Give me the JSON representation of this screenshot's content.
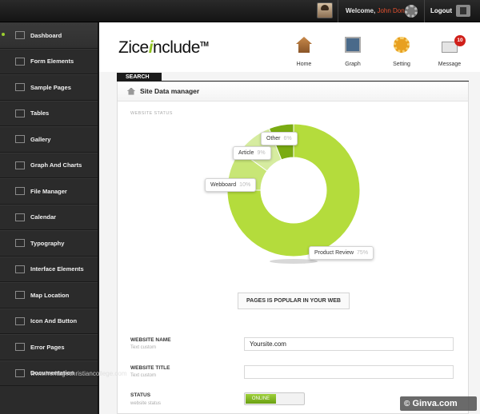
{
  "topbar": {
    "welcome_prefix": "Welcome,",
    "username": "John Don",
    "logout_label": "Logout"
  },
  "sidebar": {
    "items": [
      {
        "label": "Dashboard",
        "icon": "home-icon",
        "active": true
      },
      {
        "label": "Form Elements",
        "icon": "form-icon"
      },
      {
        "label": "Sample Pages",
        "icon": "page-icon"
      },
      {
        "label": "Tables",
        "icon": "table-icon"
      },
      {
        "label": "Gallery",
        "icon": "gallery-icon"
      },
      {
        "label": "Graph And Charts",
        "icon": "chart-icon"
      },
      {
        "label": "File Manager",
        "icon": "folder-icon"
      },
      {
        "label": "Calendar",
        "icon": "calendar-icon"
      },
      {
        "label": "Typography",
        "icon": "typography-icon"
      },
      {
        "label": "Interface Elements",
        "icon": "interface-icon"
      },
      {
        "label": "Map Location",
        "icon": "map-pin-icon"
      },
      {
        "label": "Icon And Button",
        "icon": "wrench-icon"
      },
      {
        "label": "Error Pages",
        "icon": "error-icon"
      },
      {
        "label": "Documentation",
        "icon": "document-icon"
      }
    ]
  },
  "header": {
    "logo_prefix": "Zice",
    "logo_i": "i",
    "logo_suffix": "nclude",
    "logo_tm": "TM",
    "nav": [
      {
        "label": "Home",
        "icon": "home-icon"
      },
      {
        "label": "Graph",
        "icon": "graph-icon"
      },
      {
        "label": "Setting",
        "icon": "gear-icon"
      },
      {
        "label": "Message",
        "icon": "envelope-icon",
        "badge": "10"
      }
    ]
  },
  "search_label": "SEARCH",
  "panel": {
    "title": "Site Data manager",
    "section_label": "WEBSITE STATUS",
    "chart_caption": "PAGES IS POPULAR IN YOUR WEB"
  },
  "chart_data": {
    "type": "pie",
    "style": "donut",
    "slices": [
      {
        "name": "Product Review",
        "value": 75,
        "label": "75%",
        "color": "#b4dc3c"
      },
      {
        "name": "Webboard",
        "value": 10,
        "label": "10%",
        "color": "#c8e676"
      },
      {
        "name": "Article",
        "value": 9,
        "label": "9%",
        "color": "#d6eca0"
      },
      {
        "name": "Other",
        "value": 6,
        "label": "6%",
        "color": "#7aab12"
      }
    ]
  },
  "form": {
    "website_name": {
      "label": "WEBSITE NAME",
      "sub": "Text custom",
      "value": "Yoursite.com"
    },
    "website_title": {
      "label": "WEBSITE TITLE",
      "sub": "Text custom",
      "value": ""
    },
    "status": {
      "label": "STATUS",
      "sub": "website status",
      "toggle_label": "ONLINE"
    }
  },
  "watermarks": {
    "left": "www.heritagechristiancollege.com",
    "right_symbol": "©",
    "right_text": "Ginva.com"
  }
}
